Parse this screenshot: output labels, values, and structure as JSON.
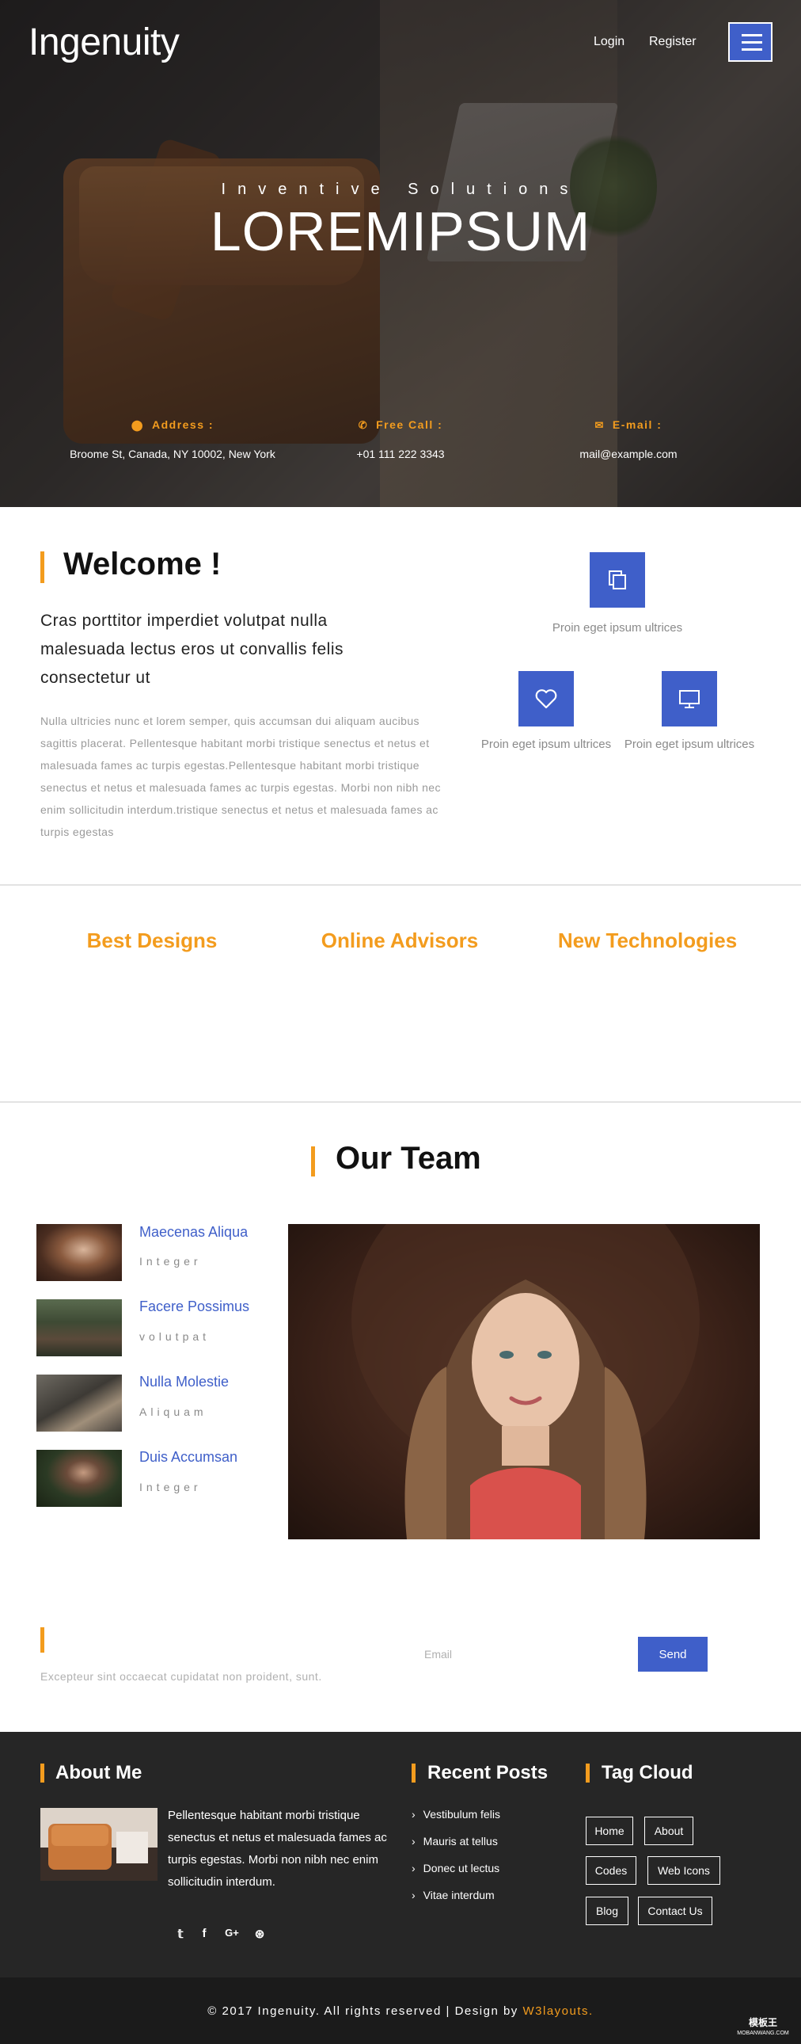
{
  "header": {
    "logo": "Ingenuity",
    "login": "Login",
    "register": "Register",
    "tagline": "Inventive Solutions",
    "headline": "LOREMIPSUM"
  },
  "contact": [
    {
      "label": "Address :",
      "icon": "map-marker-icon",
      "value": "Broome St, Canada, NY 10002, New York"
    },
    {
      "label": "Free Call :",
      "icon": "phone-icon",
      "value": "+01 111 222 3343"
    },
    {
      "label": "E-mail :",
      "icon": "envelope-icon",
      "value": "mail@example.com"
    }
  ],
  "welcome": {
    "title": "Welcome !",
    "lead": "Cras porttitor imperdiet volutpat nulla malesuada lectus eros ut convallis felis consectetur ut",
    "body": "Nulla ultricies nunc et lorem semper, quis accumsan dui aliquam aucibus sagittis placerat. Pellentesque habitant morbi tristique senectus et netus et malesuada fames ac turpis egestas.Pellentesque habitant morbi tristique senectus et netus et malesuada fames ac turpis egestas. Morbi non nibh nec enim sollicitudin interdum.tristique senectus et netus et malesuada fames ac turpis egestas",
    "features": [
      {
        "icon": "copy-icon",
        "text": "Proin eget ipsum ultrices"
      },
      {
        "icon": "heart-icon",
        "text": "Proin eget ipsum ultrices"
      },
      {
        "icon": "desktop-icon",
        "text": "Proin eget ipsum ultrices"
      }
    ]
  },
  "features": [
    "Best Designs",
    "Online Advisors",
    "New Technologies"
  ],
  "team": {
    "title": "Our Team",
    "members": [
      {
        "name": "Maecenas Aliqua",
        "role": "Integer"
      },
      {
        "name": "Facere Possimus",
        "role": "volutpat"
      },
      {
        "name": "Nulla Molestie",
        "role": "Aliquam"
      },
      {
        "name": "Duis Accumsan",
        "role": "Integer"
      }
    ]
  },
  "newsletter": {
    "text": "Excepteur sint occaecat cupidatat non proident, sunt.",
    "placeholder": "Email",
    "button": "Send"
  },
  "footer": {
    "about_title": "About Me",
    "about_text": "Pellentesque habitant morbi tristique senectus et netus et malesuada fames ac turpis egestas. Morbi non nibh nec enim sollicitudin interdum.",
    "social": [
      {
        "icon": "twitter-icon",
        "glyph": "𝕥"
      },
      {
        "icon": "facebook-icon",
        "glyph": "f"
      },
      {
        "icon": "google-plus-icon",
        "glyph": "G+"
      },
      {
        "icon": "dribbble-icon",
        "glyph": "⊛"
      }
    ],
    "posts_title": "Recent Posts",
    "posts": [
      "Vestibulum felis",
      "Mauris at tellus",
      "Donec ut lectus",
      "Vitae interdum"
    ],
    "tags_title": "Tag Cloud",
    "tags": [
      "Home",
      "About",
      "Codes",
      "Web Icons",
      "Blog",
      "Contact Us"
    ],
    "copyright_prefix": "© 2017 Ingenuity. All rights reserved | Design by",
    "copyright_brand": "W3layouts.",
    "badge_line1": "模板王",
    "badge_line2": "MOBANWANG.COM"
  },
  "colors": {
    "accent": "#f39c1e",
    "primary": "#3f5fc9",
    "footer": "#262626"
  }
}
